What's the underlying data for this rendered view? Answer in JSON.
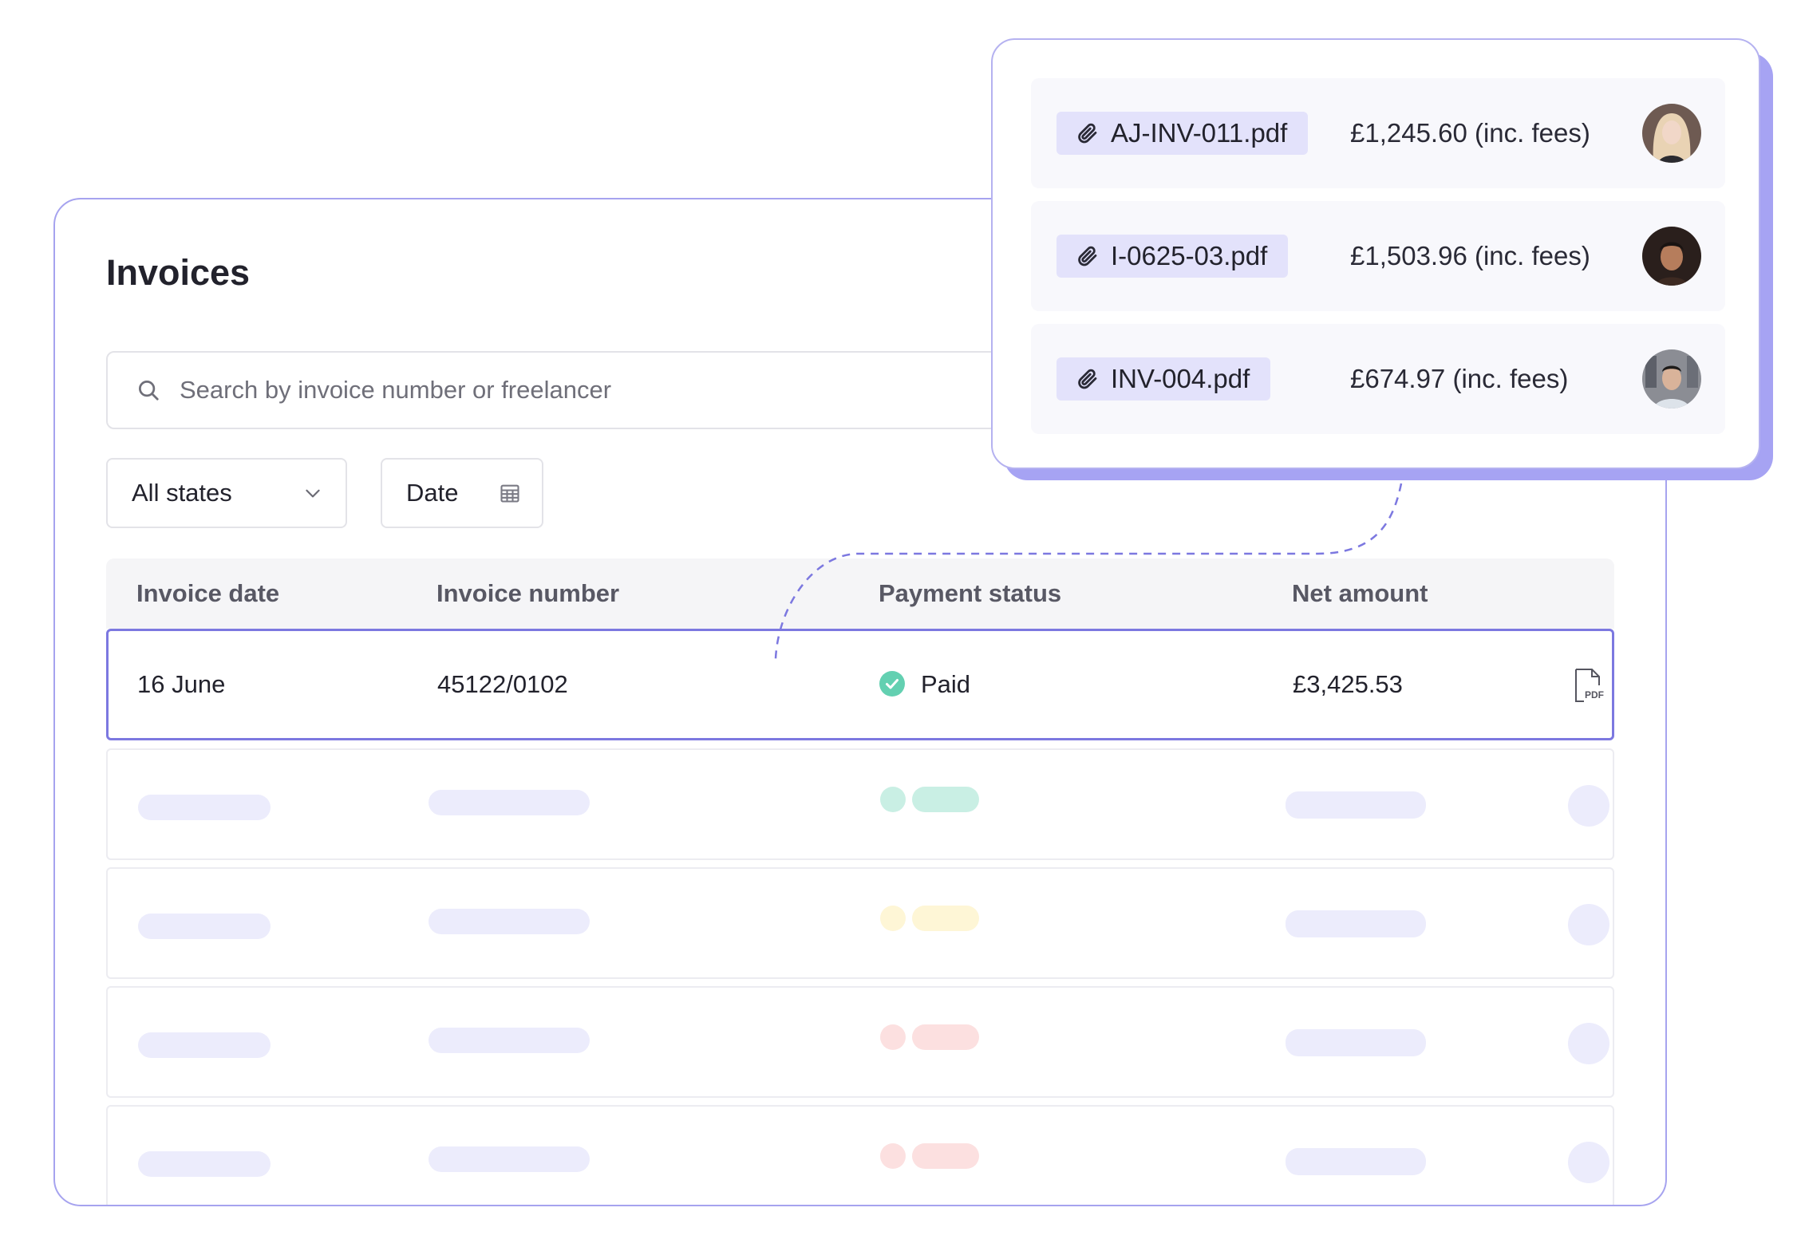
{
  "invoices": {
    "title": "Invoices",
    "search_placeholder": "Search by invoice number or freelancer",
    "filters": {
      "state_label": "All states",
      "date_label": "Date"
    },
    "columns": [
      "Invoice date",
      "Invoice number",
      "Payment status",
      "Net amount"
    ],
    "selected_row": {
      "date": "16 June",
      "number": "45122/0102",
      "status": "Paid",
      "amount": "£3,425.53",
      "file_icon": "pdf-file-icon"
    },
    "placeholder_row_status_colors": [
      "#63d0b1",
      "#fce68a",
      "#f7a5a5",
      "#f7a5a5"
    ]
  },
  "attachments": [
    {
      "file": "AJ-INV-011.pdf",
      "amount": "£1,245.60 (inc. fees)"
    },
    {
      "file": "I-0625-03.pdf",
      "amount": "£1,503.96 (inc. fees)"
    },
    {
      "file": "INV-004.pdf",
      "amount": "£674.97 (inc. fees)"
    }
  ],
  "colors": {
    "accent": "#7c78e0",
    "accent_shadow": "#a6a3f3",
    "paid_green": "#63d0b1",
    "chip_bg": "#e3e2fb"
  }
}
